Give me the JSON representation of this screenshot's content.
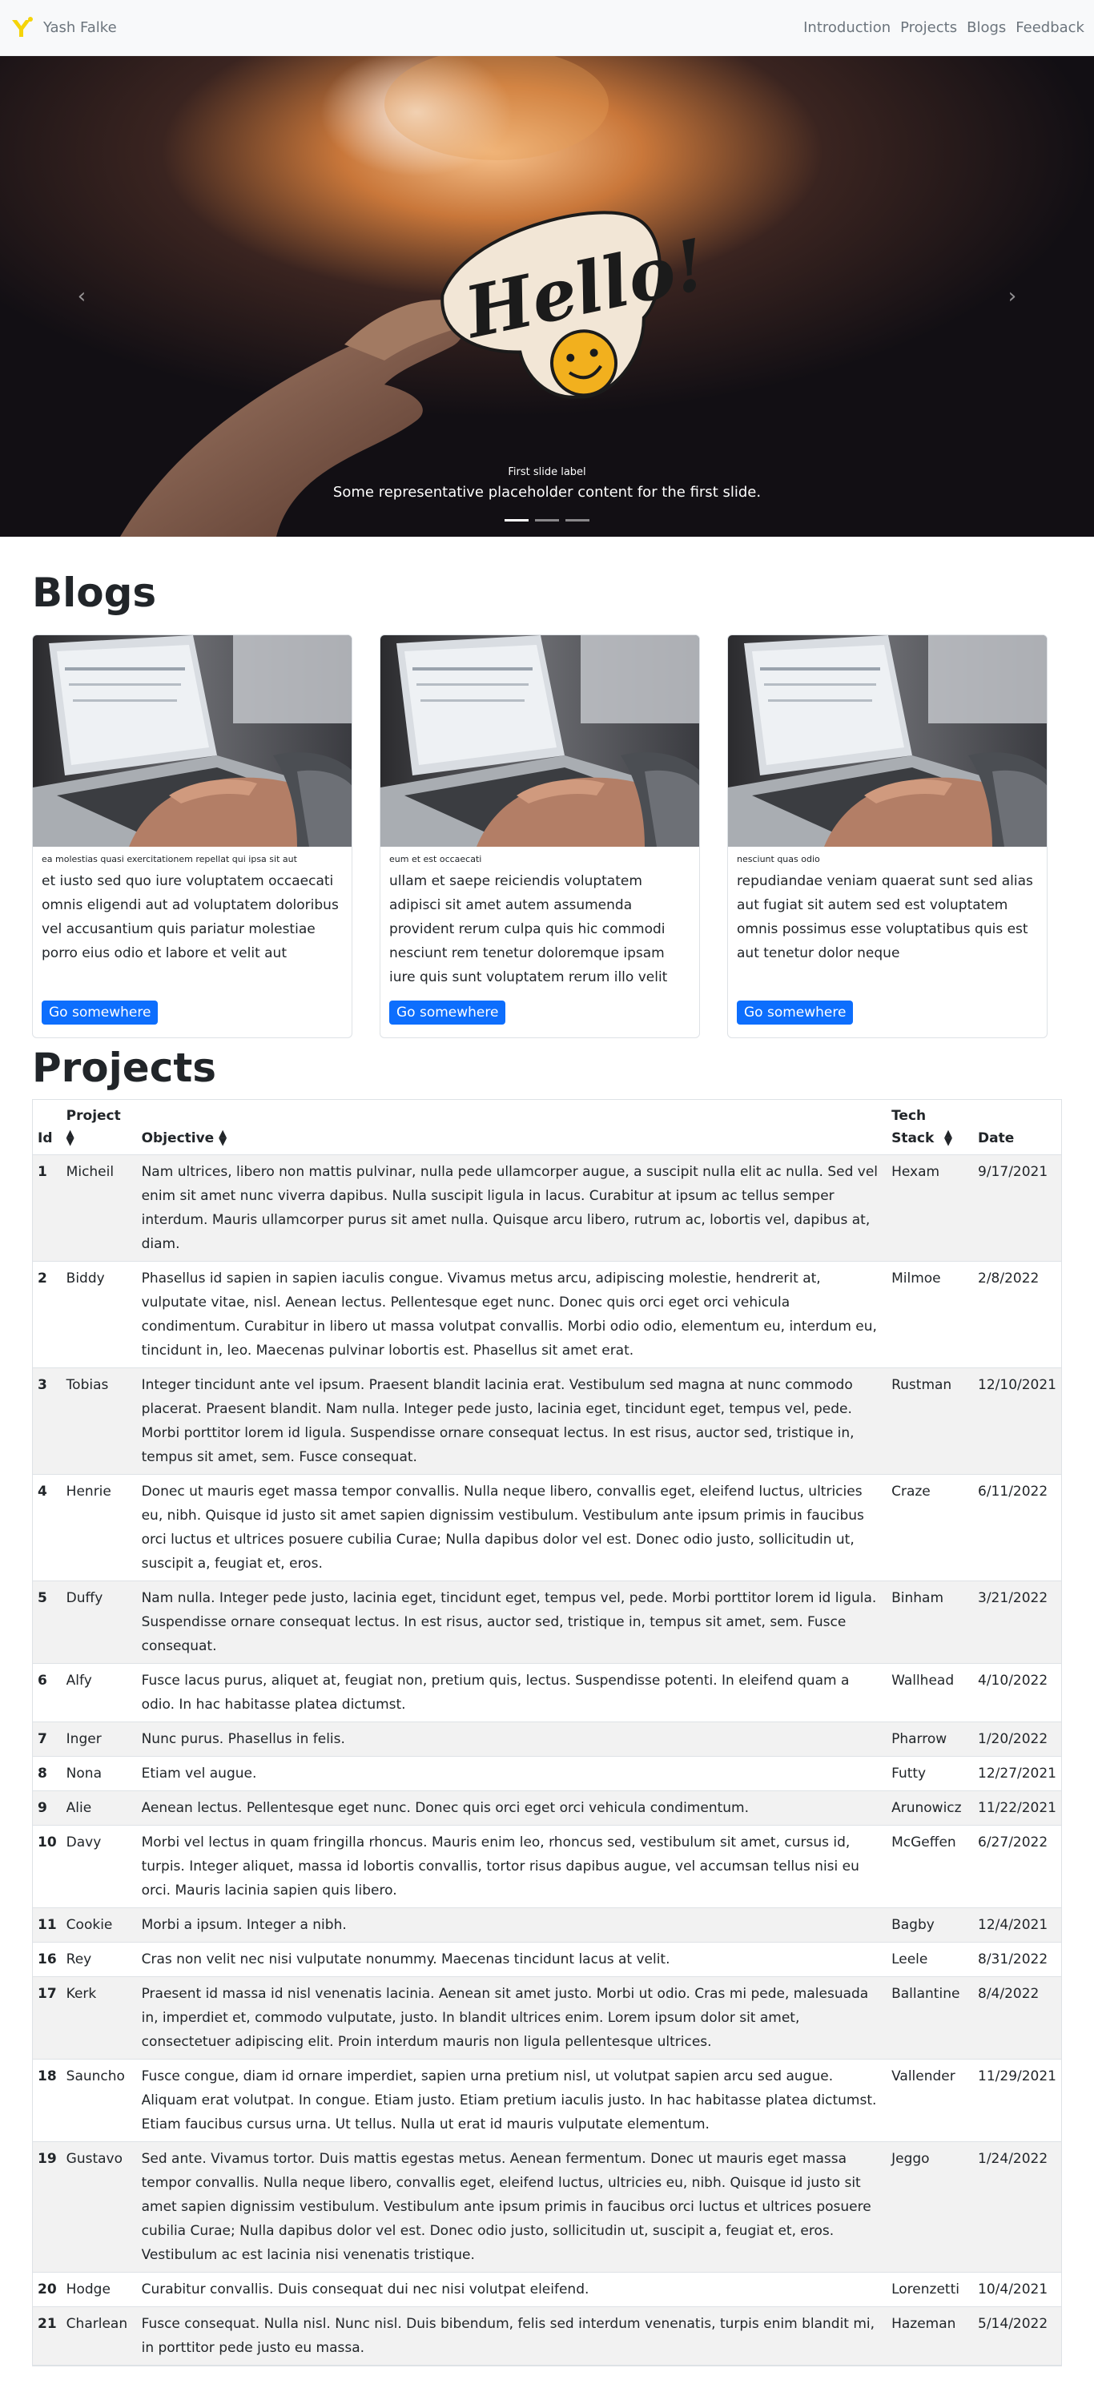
{
  "brand": {
    "name": "Yash Falke"
  },
  "nav": [
    "Introduction",
    "Projects",
    "Blogs",
    "Feedback"
  ],
  "carousel": {
    "image_text": "Hello!",
    "caption_title": "First slide label",
    "caption_text": "Some representative placeholder content for the first slide.",
    "prev_icon": "chevron-left-icon",
    "next_icon": "chevron-right-icon",
    "slides": 3,
    "active_slide": 1
  },
  "blogs": {
    "title": "Blogs",
    "cards": [
      {
        "subtitle": "ea molestias quasi exercitationem repellat qui ipsa sit aut",
        "text": "et iusto sed quo iure voluptatem occaecati omnis eligendi aut ad voluptatem doloribus vel accusantium quis pariatur molestiae porro eius odio et labore et velit aut",
        "button": "Go somewhere"
      },
      {
        "subtitle": "eum et est occaecati",
        "text": "ullam et saepe reiciendis voluptatem adipisci sit amet autem assumenda provident rerum culpa quis hic commodi nesciunt rem tenetur doloremque ipsam iure quis sunt voluptatem rerum illo velit",
        "button": "Go somewhere"
      },
      {
        "subtitle": "nesciunt quas odio",
        "text": "repudiandae veniam quaerat sunt sed alias aut fugiat sit autem sed est voluptatem omnis possimus esse voluptatibus quis est aut tenetur dolor neque",
        "button": "Go somewhere"
      }
    ]
  },
  "projects": {
    "title": "Projects",
    "headers": {
      "id": "Id",
      "name": "Project",
      "objective": "Objective",
      "stack": "Tech Stack",
      "date": "Date"
    },
    "rows": [
      [
        "1",
        "Micheil",
        "Nam ultrices, libero non mattis pulvinar, nulla pede ullamcorper augue, a suscipit nulla elit ac nulla. Sed vel enim sit amet nunc viverra dapibus. Nulla suscipit ligula in lacus. Curabitur at ipsum ac tellus semper interdum. Mauris ullamcorper purus sit amet nulla. Quisque arcu libero, rutrum ac, lobortis vel, dapibus at, diam.",
        "Hexam",
        "9/17/2021"
      ],
      [
        "2",
        "Biddy",
        "Phasellus id sapien in sapien iaculis congue. Vivamus metus arcu, adipiscing molestie, hendrerit at, vulputate vitae, nisl. Aenean lectus. Pellentesque eget nunc. Donec quis orci eget orci vehicula condimentum. Curabitur in libero ut massa volutpat convallis. Morbi odio odio, elementum eu, interdum eu, tincidunt in, leo. Maecenas pulvinar lobortis est. Phasellus sit amet erat.",
        "Milmoe",
        "2/8/2022"
      ],
      [
        "3",
        "Tobias",
        "Integer tincidunt ante vel ipsum. Praesent blandit lacinia erat. Vestibulum sed magna at nunc commodo placerat. Praesent blandit. Nam nulla. Integer pede justo, lacinia eget, tincidunt eget, tempus vel, pede. Morbi porttitor lorem id ligula. Suspendisse ornare consequat lectus. In est risus, auctor sed, tristique in, tempus sit amet, sem. Fusce consequat.",
        "Rustman",
        "12/10/2021"
      ],
      [
        "4",
        "Henrie",
        "Donec ut mauris eget massa tempor convallis. Nulla neque libero, convallis eget, eleifend luctus, ultricies eu, nibh. Quisque id justo sit amet sapien dignissim vestibulum. Vestibulum ante ipsum primis in faucibus orci luctus et ultrices posuere cubilia Curae; Nulla dapibus dolor vel est. Donec odio justo, sollicitudin ut, suscipit a, feugiat et, eros.",
        "Craze",
        "6/11/2022"
      ],
      [
        "5",
        "Duffy",
        "Nam nulla. Integer pede justo, lacinia eget, tincidunt eget, tempus vel, pede. Morbi porttitor lorem id ligula. Suspendisse ornare consequat lectus. In est risus, auctor sed, tristique in, tempus sit amet, sem. Fusce consequat.",
        "Binham",
        "3/21/2022"
      ],
      [
        "6",
        "Alfy",
        "Fusce lacus purus, aliquet at, feugiat non, pretium quis, lectus. Suspendisse potenti. In eleifend quam a odio. In hac habitasse platea dictumst.",
        "Wallhead",
        "4/10/2022"
      ],
      [
        "7",
        "Inger",
        "Nunc purus. Phasellus in felis.",
        "Pharrow",
        "1/20/2022"
      ],
      [
        "8",
        "Nona",
        "Etiam vel augue.",
        "Futty",
        "12/27/2021"
      ],
      [
        "9",
        "Alie",
        "Aenean lectus. Pellentesque eget nunc. Donec quis orci eget orci vehicula condimentum.",
        "Arunowicz",
        "11/22/2021"
      ],
      [
        "10",
        "Davy",
        "Morbi vel lectus in quam fringilla rhoncus. Mauris enim leo, rhoncus sed, vestibulum sit amet, cursus id, turpis. Integer aliquet, massa id lobortis convallis, tortor risus dapibus augue, vel accumsan tellus nisi eu orci. Mauris lacinia sapien quis libero.",
        "McGeffen",
        "6/27/2022"
      ],
      [
        "11",
        "Cookie",
        "Morbi a ipsum. Integer a nibh.",
        "Bagby",
        "12/4/2021"
      ],
      [
        "16",
        "Rey",
        "Cras non velit nec nisi vulputate nonummy. Maecenas tincidunt lacus at velit.",
        "Leele",
        "8/31/2022"
      ],
      [
        "17",
        "Kerk",
        "Praesent id massa id nisl venenatis lacinia. Aenean sit amet justo. Morbi ut odio. Cras mi pede, malesuada in, imperdiet et, commodo vulputate, justo. In blandit ultrices enim. Lorem ipsum dolor sit amet, consectetuer adipiscing elit. Proin interdum mauris non ligula pellentesque ultrices.",
        "Ballantine",
        "8/4/2022"
      ],
      [
        "18",
        "Sauncho",
        "Fusce congue, diam id ornare imperdiet, sapien urna pretium nisl, ut volutpat sapien arcu sed augue. Aliquam erat volutpat. In congue. Etiam justo. Etiam pretium iaculis justo. In hac habitasse platea dictumst. Etiam faucibus cursus urna. Ut tellus. Nulla ut erat id mauris vulputate elementum.",
        "Vallender",
        "11/29/2021"
      ],
      [
        "19",
        "Gustavo",
        "Sed ante. Vivamus tortor. Duis mattis egestas metus. Aenean fermentum. Donec ut mauris eget massa tempor convallis. Nulla neque libero, convallis eget, eleifend luctus, ultricies eu, nibh. Quisque id justo sit amet sapien dignissim vestibulum. Vestibulum ante ipsum primis in faucibus orci luctus et ultrices posuere cubilia Curae; Nulla dapibus dolor vel est. Donec odio justo, sollicitudin ut, suscipit a, feugiat et, eros. Vestibulum ac est lacinia nisi venenatis tristique.",
        "Jeggo",
        "1/24/2022"
      ],
      [
        "20",
        "Hodge",
        "Curabitur convallis. Duis consequat dui nec nisi volutpat eleifend.",
        "Lorenzetti",
        "10/4/2021"
      ],
      [
        "21",
        "Charlean",
        "Fusce consequat. Nulla nisl. Nunc nisl. Duis bibendum, felis sed interdum venenatis, turpis enim blandit mi, in porttitor pede justo eu massa.",
        "Hazeman",
        "5/14/2022"
      ]
    ]
  }
}
